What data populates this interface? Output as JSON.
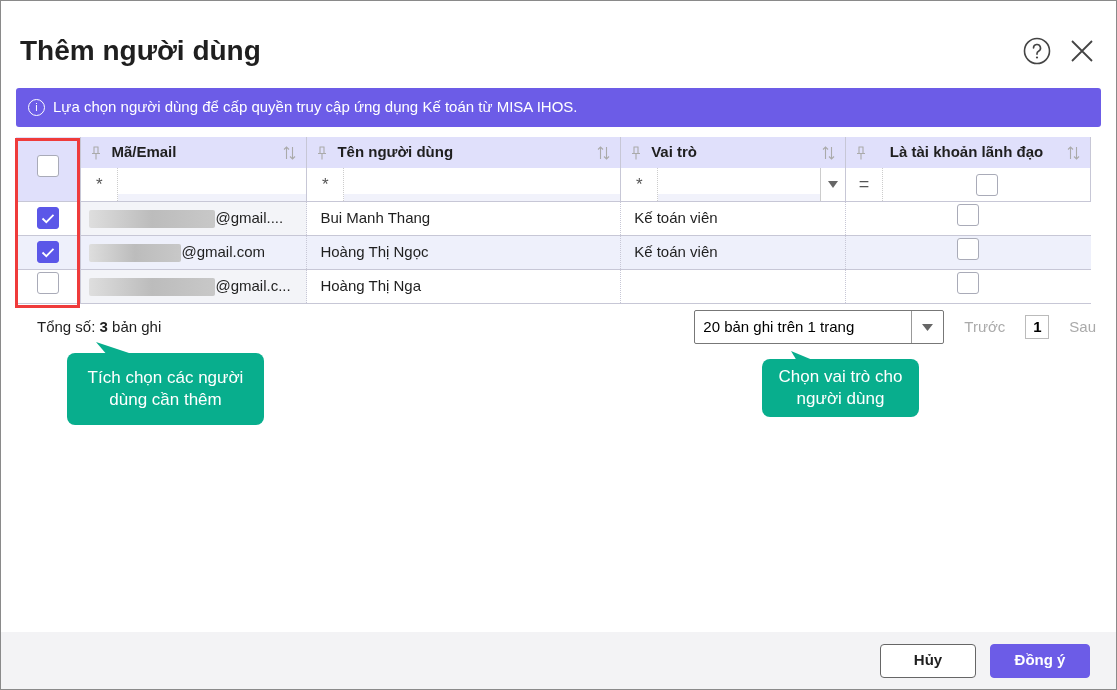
{
  "dialog": {
    "title": "Thêm người dùng"
  },
  "info_banner": {
    "icon": "i",
    "text": "Lựa chọn người dùng để cấp quyền truy cập ứng dụng Kế toán từ MISA IHOS."
  },
  "table": {
    "header_checkbox": {
      "checked": false
    },
    "columns": [
      {
        "label": "Mã/Email",
        "filter_op": "*",
        "kind": "text"
      },
      {
        "label": "Tên người dùng",
        "filter_op": "*",
        "kind": "text"
      },
      {
        "label": "Vai trò",
        "filter_op": "*",
        "kind": "dropdown"
      },
      {
        "label": "Là tài khoản lãnh đạo",
        "filter_op": "=",
        "kind": "checkbox",
        "filter_checked": false
      }
    ],
    "rows": [
      {
        "checked": true,
        "hovered": false,
        "email": "@gmail....",
        "name": "Bui Manh Thang",
        "role": "Kế toán viên",
        "leader": false
      },
      {
        "checked": true,
        "hovered": true,
        "email": "@gmail.com",
        "name": "Hoàng Thị Ngọc",
        "role": "Kế toán viên",
        "leader": false
      },
      {
        "checked": false,
        "hovered": false,
        "email": "@gmail.c...",
        "name": "Hoàng Thị Nga",
        "role": "",
        "leader": false
      }
    ]
  },
  "footer_info": {
    "total": "Tổng số: **3** bản ghi"
  },
  "pagination": {
    "page_size": "20 bản ghi trên 1 trang",
    "prev": "Trước",
    "page": "1",
    "next": "Sau"
  },
  "callouts": [
    {
      "text": "Tích chọn các người dùng cần thêm"
    },
    {
      "text": "Chọn vai trò cho người dùng"
    }
  ],
  "buttons": [
    {
      "label": "Hủy",
      "kind": "secondary"
    },
    {
      "label": "Đồng ý",
      "kind": "primary"
    }
  ]
}
